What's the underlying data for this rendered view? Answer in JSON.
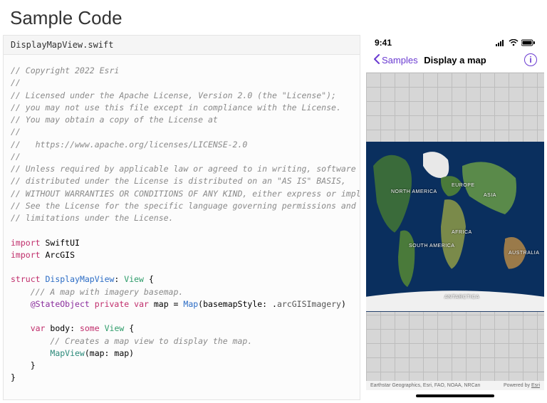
{
  "heading": "Sample Code",
  "code": {
    "filename": "DisplayMapView.swift",
    "tokens": [
      [
        {
          "t": "// Copyright 2022 Esri",
          "c": "c-comment"
        }
      ],
      [
        {
          "t": "//",
          "c": "c-comment"
        }
      ],
      [
        {
          "t": "// Licensed under the Apache License, Version 2.0 (the \"License\");",
          "c": "c-comment"
        }
      ],
      [
        {
          "t": "// you may not use this file except in compliance with the License.",
          "c": "c-comment"
        }
      ],
      [
        {
          "t": "// You may obtain a copy of the License at",
          "c": "c-comment"
        }
      ],
      [
        {
          "t": "//",
          "c": "c-comment"
        }
      ],
      [
        {
          "t": "//   https://www.apache.org/licenses/LICENSE-2.0",
          "c": "c-comment"
        }
      ],
      [
        {
          "t": "//",
          "c": "c-comment"
        }
      ],
      [
        {
          "t": "// Unless required by applicable law or agreed to in writing, software",
          "c": "c-comment"
        }
      ],
      [
        {
          "t": "// distributed under the License is distributed on an \"AS IS\" BASIS,",
          "c": "c-comment"
        }
      ],
      [
        {
          "t": "// WITHOUT WARRANTIES OR CONDITIONS OF ANY KIND, either express or implied.",
          "c": "c-comment"
        }
      ],
      [
        {
          "t": "// See the License for the specific language governing permissions and",
          "c": "c-comment"
        }
      ],
      [
        {
          "t": "// limitations under the License.",
          "c": "c-comment"
        }
      ],
      [],
      [
        {
          "t": "import",
          "c": "c-keyword"
        },
        {
          "t": " SwiftUI",
          "c": "c-import"
        }
      ],
      [
        {
          "t": "import",
          "c": "c-keyword"
        },
        {
          "t": " ArcGIS",
          "c": "c-import"
        }
      ],
      [],
      [
        {
          "t": "struct",
          "c": "c-keyword"
        },
        {
          "t": " ",
          "c": ""
        },
        {
          "t": "DisplayMapView",
          "c": "c-type"
        },
        {
          "t": ": ",
          "c": ""
        },
        {
          "t": "View",
          "c": "c-prop"
        },
        {
          "t": " {",
          "c": ""
        }
      ],
      [
        {
          "t": "    /// A map with imagery basemap.",
          "c": "c-comment"
        }
      ],
      [
        {
          "t": "    ",
          "c": ""
        },
        {
          "t": "@StateObject",
          "c": "c-attr"
        },
        {
          "t": " ",
          "c": ""
        },
        {
          "t": "private",
          "c": "c-keyword"
        },
        {
          "t": " ",
          "c": ""
        },
        {
          "t": "var",
          "c": "c-keyword"
        },
        {
          "t": " map = ",
          "c": ""
        },
        {
          "t": "Map",
          "c": "c-type"
        },
        {
          "t": "(basemapStyle: .",
          "c": ""
        },
        {
          "t": "arcGISImagery",
          "c": "c-enum"
        },
        {
          "t": ")",
          "c": ""
        }
      ],
      [],
      [
        {
          "t": "    ",
          "c": ""
        },
        {
          "t": "var",
          "c": "c-keyword"
        },
        {
          "t": " body: ",
          "c": ""
        },
        {
          "t": "some",
          "c": "c-keyword"
        },
        {
          "t": " ",
          "c": ""
        },
        {
          "t": "View",
          "c": "c-prop"
        },
        {
          "t": " {",
          "c": ""
        }
      ],
      [
        {
          "t": "        // Creates a map view to display the map.",
          "c": "c-comment"
        }
      ],
      [
        {
          "t": "        ",
          "c": ""
        },
        {
          "t": "MapView",
          "c": "c-func"
        },
        {
          "t": "(map: map)",
          "c": ""
        }
      ],
      [
        {
          "t": "    }",
          "c": ""
        }
      ],
      [
        {
          "t": "}",
          "c": ""
        }
      ]
    ]
  },
  "device": {
    "status_time": "9:41",
    "nav": {
      "back_label": "Samples",
      "title": "Display a map",
      "info_glyph": "i"
    },
    "map_labels": {
      "na": "NORTH\nAMERICA",
      "sa": "SOUTH\nAMERICA",
      "eu": "EUROPE",
      "af": "AFRICA",
      "as": "ASIA",
      "au": "AUSTRALIA",
      "an": "ANTARCTICA"
    },
    "attribution_left": "Earthstar Geographics, Esri, FAO, NOAA, NRCan",
    "attribution_right_prefix": "Powered by ",
    "attribution_right_link": "Esri"
  }
}
